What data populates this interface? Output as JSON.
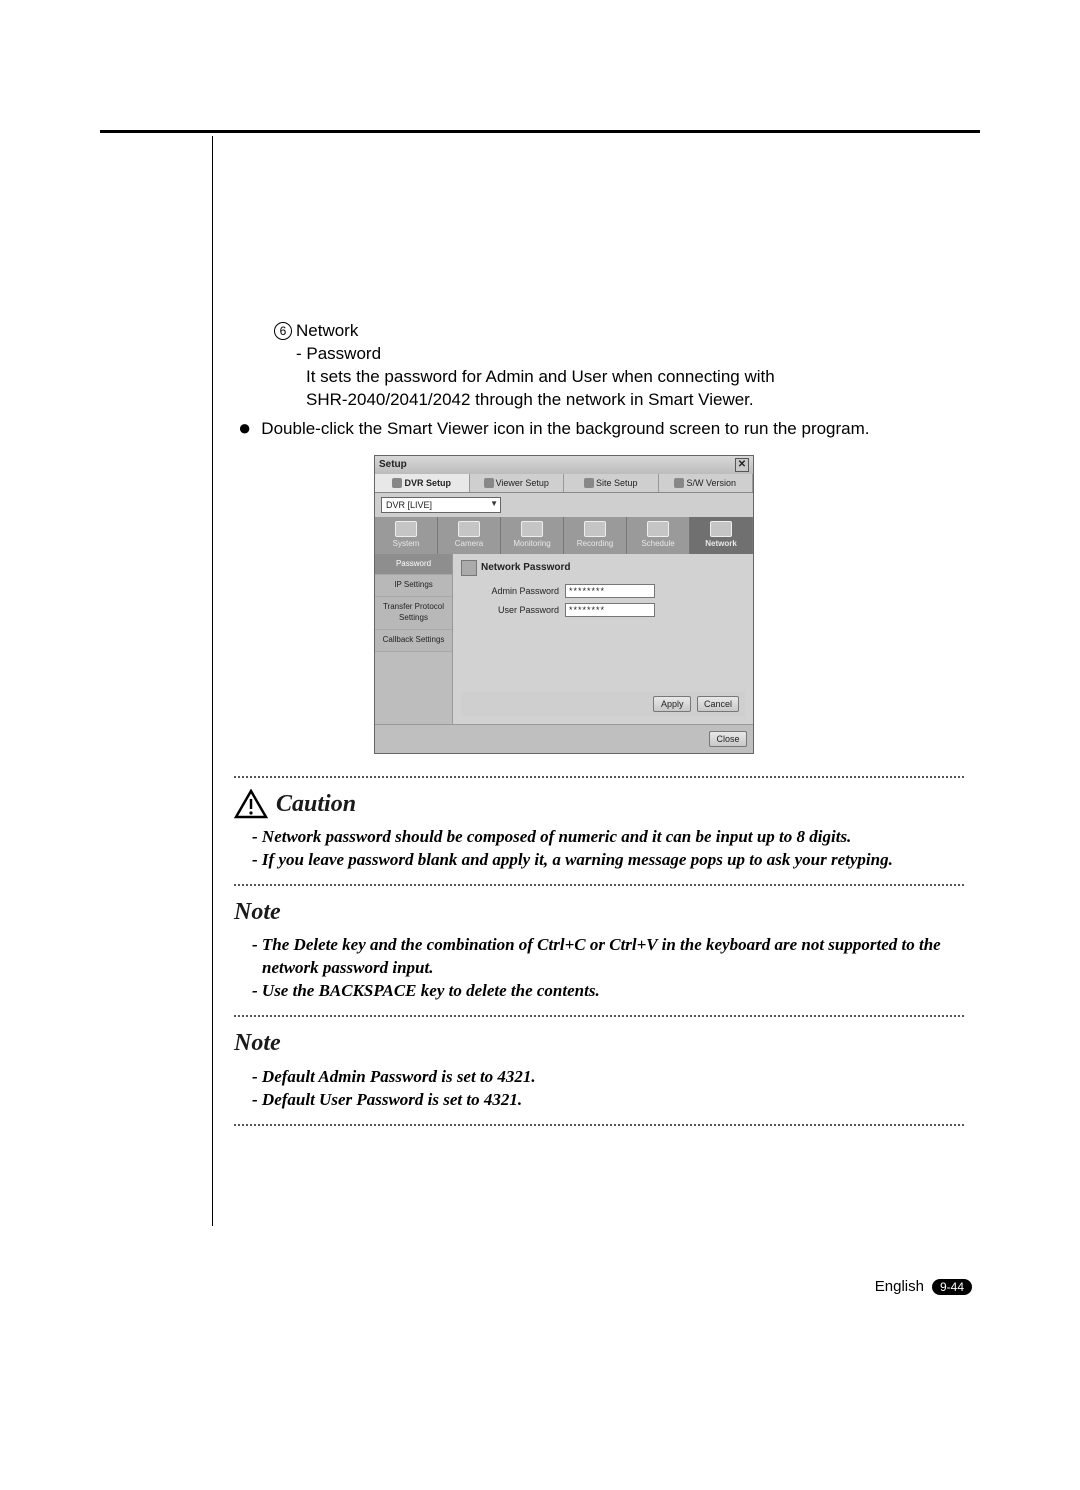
{
  "circ_number": "6",
  "heading_network": "Network",
  "sub_password": "- Password",
  "desc_line1": "It sets the password for Admin and User when connecting with",
  "desc_line2": "SHR-2040/2041/2042 through the network in Smart Viewer.",
  "bullet_text": "Double-click the Smart Viewer icon in the background screen to run the program.",
  "shot": {
    "title": "Setup",
    "tabs": [
      "DVR Setup",
      "Viewer Setup",
      "Site Setup",
      "S/W Version"
    ],
    "dvr_label": "DVR [LIVE]",
    "icons": [
      "System",
      "Camera",
      "Monitoring",
      "Recording",
      "Schedule",
      "Network"
    ],
    "side": [
      "Password",
      "IP Settings",
      "Transfer Protocol Settings",
      "Callback Settings"
    ],
    "panel_title": "Network Password",
    "admin_lbl": "Admin Password",
    "user_lbl": "User Password",
    "masked": "********",
    "apply": "Apply",
    "cancel": "Cancel",
    "close": "Close"
  },
  "caution_title": "Caution",
  "caution1": "- Network password should be composed of numeric and it can be input up to 8 digits.",
  "caution2": "- If you leave password blank and apply it, a warning message pops up to ask your retyping.",
  "note_title": "Note",
  "noteA1": "- The Delete key and the combination of Ctrl+C or Ctrl+V in the keyboard are not supported to the network password input.",
  "noteA2": "- Use the BACKSPACE key to delete the contents.",
  "noteB1": "- Default Admin Password is set to 4321.",
  "noteB2": "- Default User Password is set to 4321.",
  "footer_lang": "English",
  "footer_page": "9-44"
}
